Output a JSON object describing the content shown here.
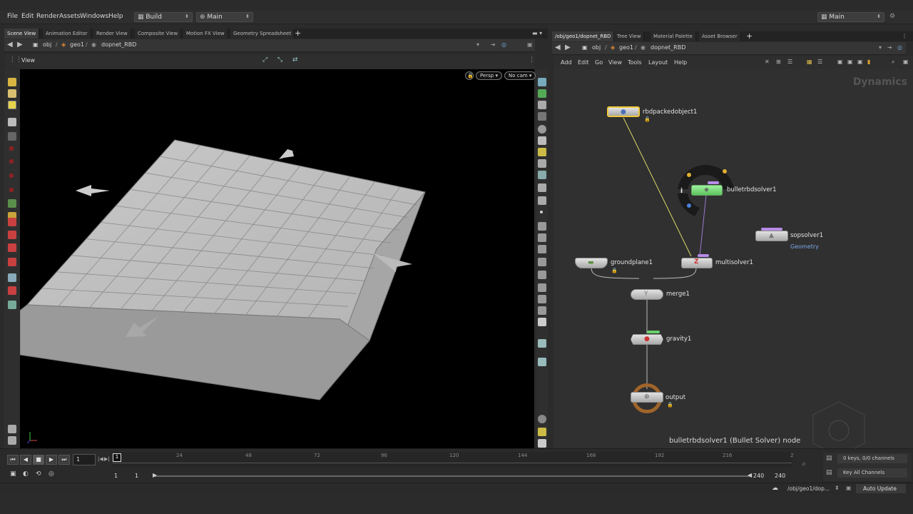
{
  "menubar": {
    "items": [
      "File",
      "Edit",
      "Render",
      "Assets",
      "Windows",
      "Help"
    ],
    "desktop": "Build",
    "layout": "Main",
    "right_dropdown": "Main"
  },
  "left_pane": {
    "tabs": [
      "Scene View",
      "Animation Editor",
      "Render View",
      "Composite View",
      "Motion FX View",
      "Geometry Spreadsheet"
    ],
    "path": [
      "obj",
      "geo1",
      "dopnet_RBD"
    ],
    "view_label": "View",
    "camera": "Persp",
    "cam_select": "No cam"
  },
  "right_pane": {
    "tabs": [
      "/obj/geo1/dopnet_RBD",
      "Tree View",
      "Material Palette",
      "Asset Browser"
    ],
    "path": [
      "obj",
      "geo1",
      "dopnet_RBD"
    ],
    "menu": [
      "Add",
      "Edit",
      "Go",
      "View",
      "Tools",
      "Layout",
      "Help"
    ],
    "context_label": "Dynamics",
    "footer_label": "bulletrbdsolver1 (Bullet Solver) node",
    "nodes": {
      "rbdpackedobject": "rbdpackedobject1",
      "bulletrbdsolver": "bulletrbdsolver1",
      "sopsolver": "sopsolver1",
      "sopsolver_sub": "Geometry",
      "groundplane": "groundplane1",
      "multisolver": "multisolver1",
      "merge": "merge1",
      "gravity": "gravity1",
      "output": "output"
    },
    "ring_info": "i"
  },
  "timeline": {
    "frame": "1",
    "ticks": [
      "24",
      "48",
      "72",
      "96",
      "120",
      "144",
      "168",
      "192",
      "216",
      "2"
    ],
    "range_start": "1",
    "range_start2": "1",
    "range_end": "240",
    "range_end2": "240",
    "current_frame_marker": "1",
    "keys_label": "0 keys, 0/0 channels",
    "key_all": "Key All Channels"
  },
  "statusbar": {
    "path": "/obj/geo1/dop...",
    "update_mode": "Auto Update"
  },
  "colors": {
    "selected_node": "#f0c93a",
    "active_node": "#7ee07e",
    "purple_flag": "#b78ce8",
    "output_ring": "#a0642a",
    "wire_yellow": "#d8d86a",
    "wire_purple": "#9a7ad0"
  }
}
